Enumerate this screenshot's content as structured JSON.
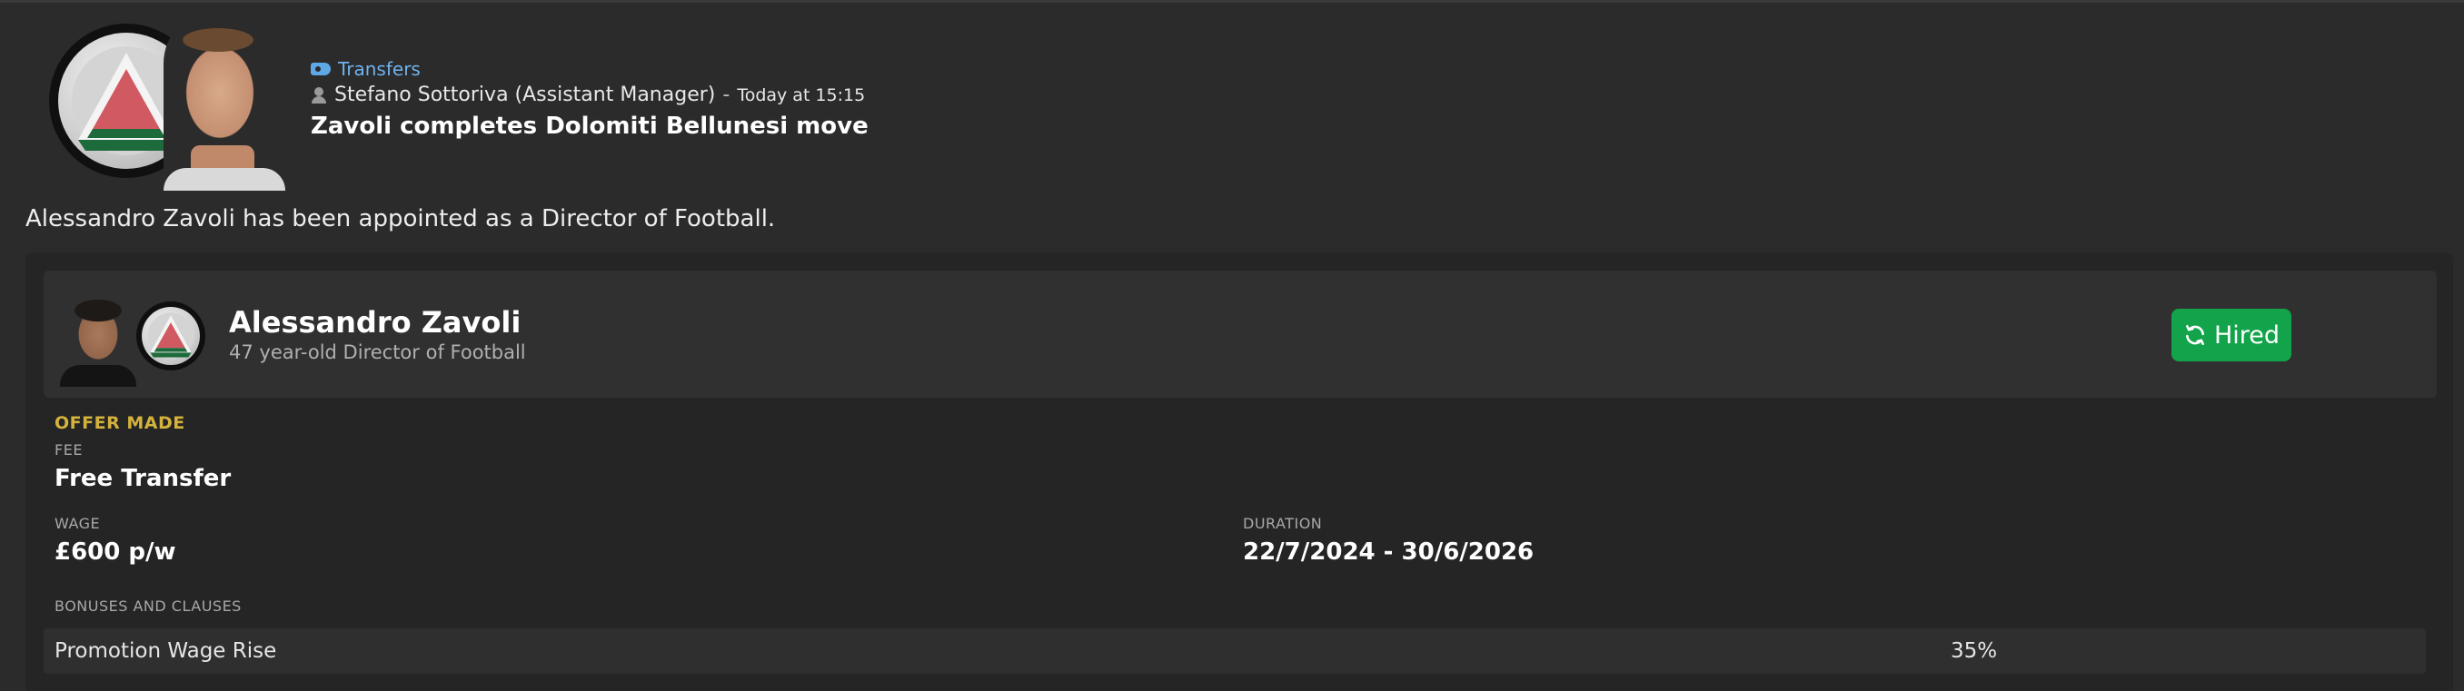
{
  "news": {
    "category": "Transfers",
    "author": "Stefano Sottoriva (Assistant Manager)",
    "separator": "-",
    "time": "Today at 15:15",
    "headline": "Zavoli completes Dolomiti Bellunesi move",
    "body": "Alessandro Zavoli has been appointed as a Director of Football."
  },
  "person": {
    "name": "Alessandro Zavoli",
    "subtitle": "47 year-old Director of Football",
    "status_button": "Hired"
  },
  "offer": {
    "heading": "OFFER MADE",
    "fee_label": "FEE",
    "fee_value": "Free Transfer",
    "wage_label": "WAGE",
    "wage_value": "£600 p/w",
    "duration_label": "DURATION",
    "duration_value": "22/7/2024 - 30/6/2026",
    "bonuses_label": "BONUSES AND CLAUSES",
    "clauses": [
      {
        "name": "Promotion Wage Rise",
        "value": "35%"
      }
    ]
  },
  "colors": {
    "background": "#2b2b2b",
    "accent_link": "#6fb3ee",
    "offer_heading": "#d4b33c",
    "hired_button": "#13a34a",
    "badge_red": "#d15a62",
    "badge_green": "#1d6a3a"
  },
  "icons": [
    "tag-icon",
    "person-icon",
    "refresh-icon",
    "club-badge",
    "manager-photo",
    "player-photo"
  ]
}
